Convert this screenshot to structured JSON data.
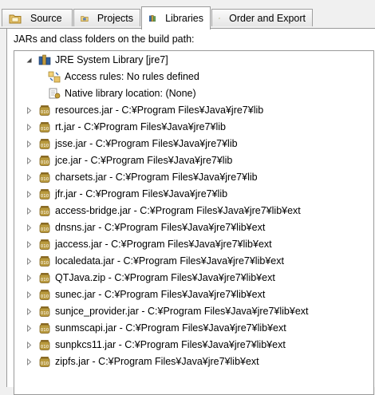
{
  "tabs": [
    {
      "label": "Source",
      "icon": "source-folder-icon",
      "active": false
    },
    {
      "label": "Projects",
      "icon": "projects-icon",
      "active": false
    },
    {
      "label": "Libraries",
      "icon": "libraries-icon",
      "active": true
    },
    {
      "label": "Order and Export",
      "icon": "order-export-icon",
      "active": false
    }
  ],
  "panel": {
    "heading": "JARs and class folders on the build path:"
  },
  "tree": {
    "root": {
      "label": "JRE System Library [jre7]",
      "icon": "library-icon",
      "expanded": true
    },
    "attributes": [
      {
        "label": "Access rules: No rules defined",
        "icon": "access-rules-icon"
      },
      {
        "label": "Native library location: (None)",
        "icon": "native-library-icon"
      }
    ],
    "jars": [
      {
        "label": "resources.jar - C:¥Program Files¥Java¥jre7¥lib"
      },
      {
        "label": "rt.jar - C:¥Program Files¥Java¥jre7¥lib"
      },
      {
        "label": "jsse.jar - C:¥Program Files¥Java¥jre7¥lib"
      },
      {
        "label": "jce.jar - C:¥Program Files¥Java¥jre7¥lib"
      },
      {
        "label": "charsets.jar - C:¥Program Files¥Java¥jre7¥lib"
      },
      {
        "label": "jfr.jar - C:¥Program Files¥Java¥jre7¥lib"
      },
      {
        "label": "access-bridge.jar - C:¥Program Files¥Java¥jre7¥lib¥ext"
      },
      {
        "label": "dnsns.jar - C:¥Program Files¥Java¥jre7¥lib¥ext"
      },
      {
        "label": "jaccess.jar - C:¥Program Files¥Java¥jre7¥lib¥ext"
      },
      {
        "label": "localedata.jar - C:¥Program Files¥Java¥jre7¥lib¥ext"
      },
      {
        "label": "QTJava.zip - C:¥Program Files¥Java¥jre7¥lib¥ext"
      },
      {
        "label": "sunec.jar - C:¥Program Files¥Java¥jre7¥lib¥ext"
      },
      {
        "label": "sunjce_provider.jar - C:¥Program Files¥Java¥jre7¥lib¥ext"
      },
      {
        "label": "sunmscapi.jar - C:¥Program Files¥Java¥jre7¥lib¥ext"
      },
      {
        "label": "sunpkcs11.jar - C:¥Program Files¥Java¥jre7¥lib¥ext"
      },
      {
        "label": "zipfs.jar - C:¥Program Files¥Java¥jre7¥lib¥ext"
      }
    ],
    "jar_icon": "jar-icon",
    "collapsed_twisty_icon": "chevron-right-icon"
  },
  "colors": {
    "jar_icon": "#b99a3e",
    "library_icon": "#2f5f9c",
    "selection_border": "#c0c0c0"
  }
}
